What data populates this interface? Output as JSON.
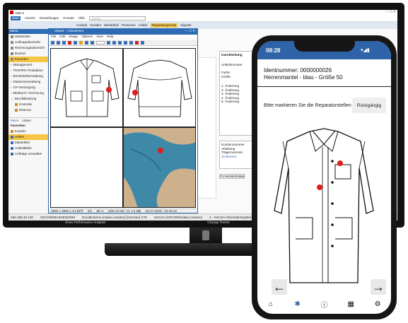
{
  "erp": {
    "app_title": "ABS 6",
    "menu": [
      "Start",
      "Ansicht",
      "Einstellungen",
      "Fenster",
      "Hilfe"
    ],
    "search_placeholder": "Suche",
    "tabs": [
      "Cockpit",
      "Kunden",
      "Mietartikel",
      "Personen",
      "Artikel",
      "Reparaturgründe",
      "Signale"
    ],
    "sidebar_header": "Menü",
    "sidebar_items": [
      "Startseiten",
      "Auftragsübersicht",
      "Rechnungsübersicht",
      "Buchen",
      "Favoriten",
      "Management",
      "TEXPRO Produktion",
      "Bereitstellverwaltung",
      "Stationsverwaltung",
      "CP-Versorgung",
      "Mietbuch / Rechnung",
      "Berufskleidung",
      "Kontrolle",
      "Reserve"
    ],
    "sidebar_section2": "Favoriten",
    "sidebar_favorites": [
      "Kunden",
      "Artikel",
      "Mietartikel",
      "Artikelbilder",
      "Aufträge verwalten"
    ],
    "sidebar_tabs": [
      "Menü",
      "Listen"
    ],
    "statusbar": [
      "192.168.10.140",
      "SOCOM\\MASSEDOOM",
      "DocaB.Demo (makeu.maxten) [German] V78",
      "SoCom (SOCOM\\makeu.maxten)",
      "1 - SoCom Informationsysteme GmbH"
    ],
    "statusbar2": [
      "Show Performance Analysis",
      "Change Theme",
      "Show me"
    ],
    "form": {
      "title": "Garnkleidung",
      "trager_label": "Trägernummer",
      "farbe_label": "Farbe",
      "grosse_label": "Größe",
      "artikel_label": "Artikelnummer",
      "changes": [
        "1. Änderung",
        "2. Änderung",
        "3. Änderung",
        "4. Änderung",
        "5. Änderung"
      ],
      "kunde_label": "Kundennummer",
      "abteilung_label": "Abteilung",
      "tragernum_label": "Trägernummer",
      "tragernum_value": "15 Beramt",
      "button": "F1 Verzeichnisse",
      "checkbox": "automatisch",
      "section": "Änderung"
    }
  },
  "viewer": {
    "title": "Viewer - Aufnahmen",
    "menu": [
      "File",
      "Edit",
      "Image",
      "Options",
      "View",
      "Help"
    ],
    "status": [
      "2990 x 2990 x 24 BPP",
      "2/2",
      "38 %",
      "1/66  10 KB / 11 x 8 MB",
      "29.07.2020 / 15:45:22"
    ]
  },
  "phone": {
    "time": "08:28",
    "ident_line": "Identnummer: 0000000026",
    "item_line": "Herrenmantel - blau - Größe 50",
    "hint": "Bitte markieren Sie die Reparaturstellen",
    "undo_label": "Rückgängig",
    "prev_icon": "arrow-left-icon",
    "next_icon": "arrow-right-icon",
    "nav_icons": [
      "home-icon",
      "tools-icon",
      "info-icon",
      "calendar-icon",
      "gear-icon"
    ],
    "accent": "#2f63a8",
    "marker_color": "#e21b1b"
  }
}
